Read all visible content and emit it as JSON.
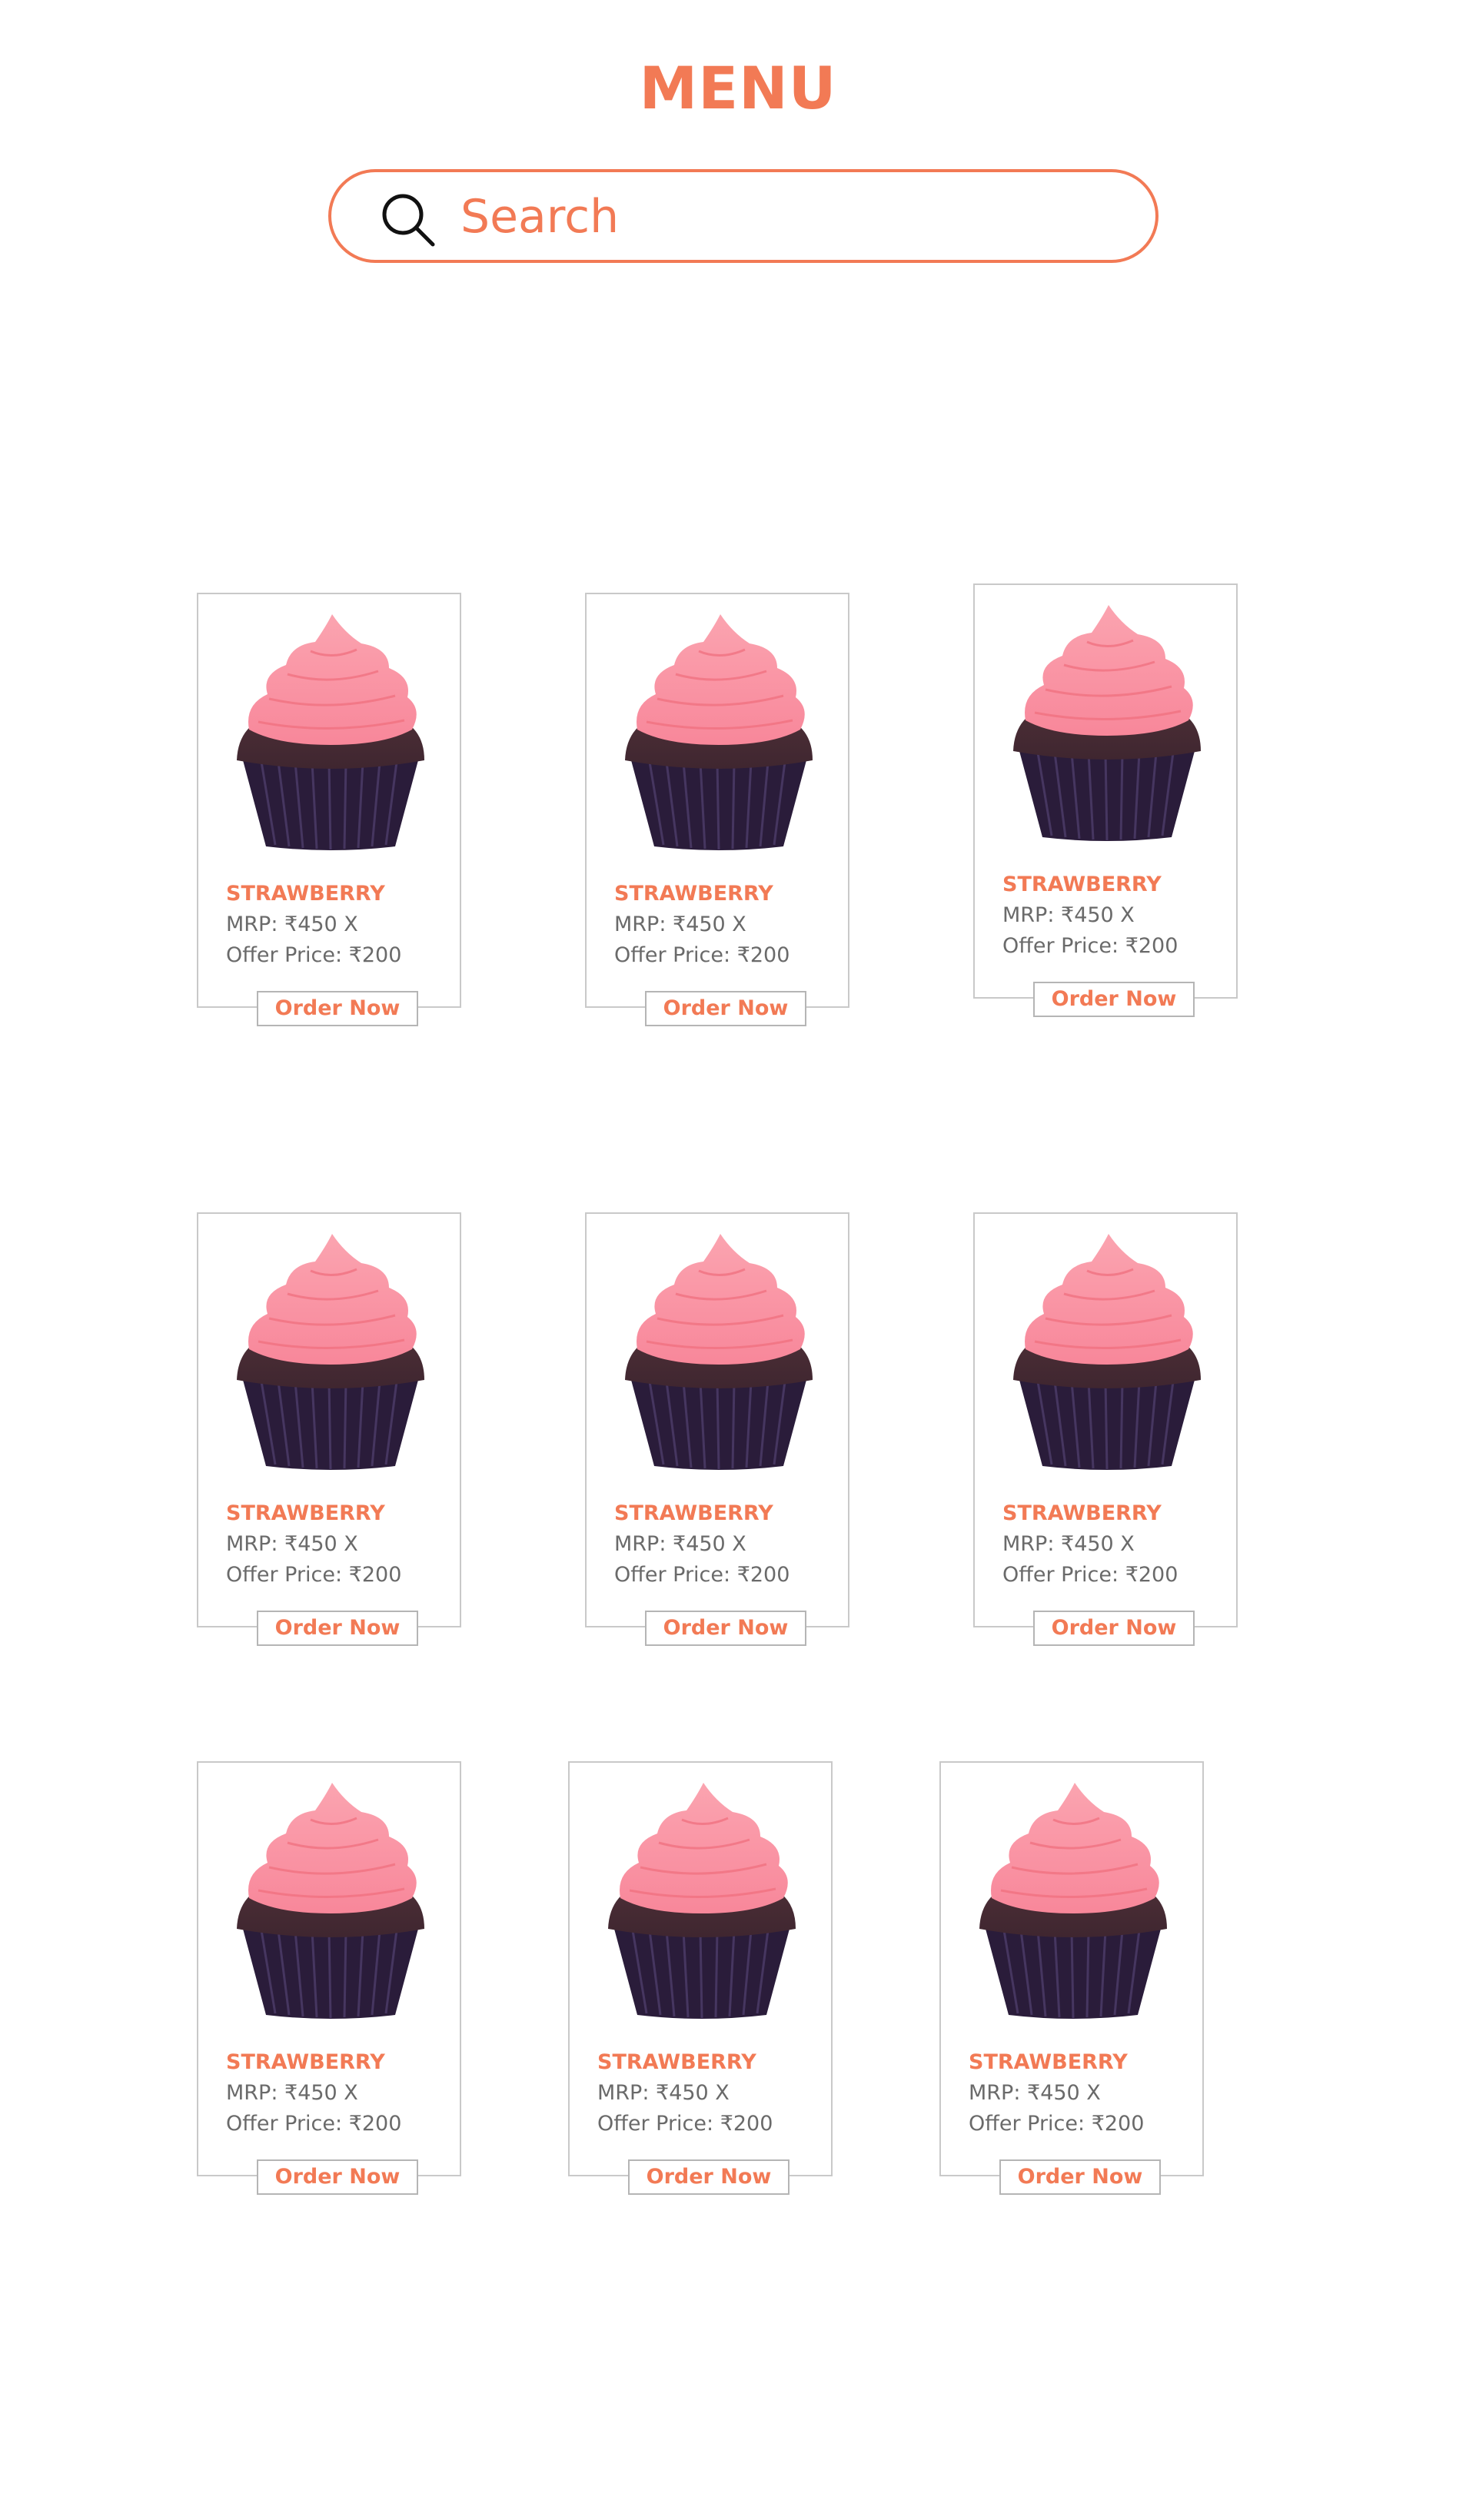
{
  "header": {
    "title": "MENU"
  },
  "search": {
    "placeholder": "Search",
    "icon": "search-icon"
  },
  "colors": {
    "accent": "#f27a55",
    "frosting": "#f8879a",
    "cake": "#3f2630",
    "liner": "#2a1c3a",
    "text": "#6a6a6a",
    "border": "#c9c9c9"
  },
  "products": [
    {
      "name": "STRAWBERRY",
      "mrp": "MRP: ₹450 X",
      "offer": "Offer Price:  ₹200",
      "button": "Order Now"
    },
    {
      "name": "STRAWBERRY",
      "mrp": "MRP: ₹450 X",
      "offer": "Offer Price:  ₹200",
      "button": "Order Now"
    },
    {
      "name": "STRAWBERRY",
      "mrp": "MRP: ₹450 X",
      "offer": "Offer Price:  ₹200",
      "button": "Order Now"
    },
    {
      "name": "STRAWBERRY",
      "mrp": "MRP: ₹450 X",
      "offer": "Offer Price:  ₹200",
      "button": "Order Now"
    },
    {
      "name": "STRAWBERRY",
      "mrp": "MRP: ₹450 X",
      "offer": "Offer Price:  ₹200",
      "button": "Order Now"
    },
    {
      "name": "STRAWBERRY",
      "mrp": "MRP: ₹450 X",
      "offer": "Offer Price:  ₹200",
      "button": "Order Now"
    },
    {
      "name": "STRAWBERRY",
      "mrp": "MRP: ₹450 X",
      "offer": "Offer Price:  ₹200",
      "button": "Order Now"
    },
    {
      "name": "STRAWBERRY",
      "mrp": "MRP: ₹450 X",
      "offer": "Offer Price:  ₹200",
      "button": "Order Now"
    },
    {
      "name": "STRAWBERRY",
      "mrp": "MRP: ₹450 X",
      "offer": "Offer Price:  ₹200",
      "button": "Order Now"
    }
  ]
}
